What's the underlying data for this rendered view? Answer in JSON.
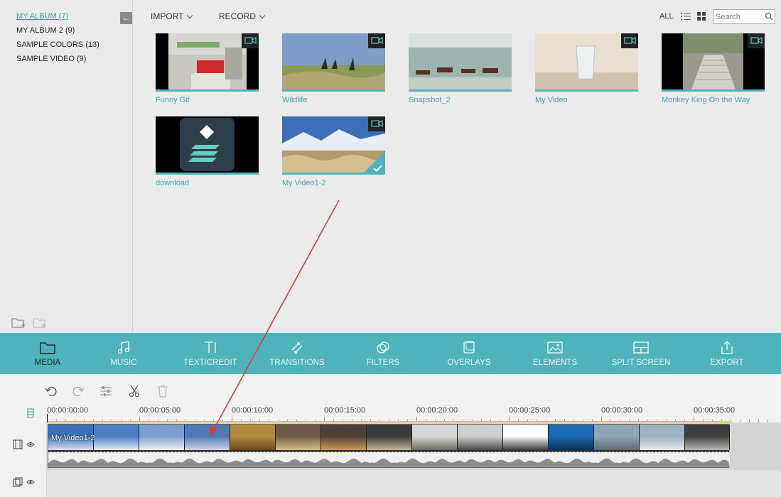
{
  "sidebar": {
    "albums": [
      {
        "label": "MY ALBUM (7)",
        "active": true
      },
      {
        "label": "MY ALBUM 2 (9)",
        "active": false
      },
      {
        "label": "SAMPLE COLORS (13)",
        "active": false
      },
      {
        "label": "SAMPLE VIDEO (9)",
        "active": false
      }
    ]
  },
  "top_toolbar": {
    "import_label": "IMPORT",
    "record_label": "RECORD",
    "all_label": "ALL",
    "search_placeholder": "Search"
  },
  "media": [
    {
      "label": "Funny Gif",
      "video": true
    },
    {
      "label": "Wildlife",
      "video": true
    },
    {
      "label": "Snapshot_2",
      "video": false
    },
    {
      "label": "My Video",
      "video": true
    },
    {
      "label": "Monkey King On the Way",
      "video": true
    },
    {
      "label": "download",
      "video": false
    },
    {
      "label": "My Video1-2",
      "video": true,
      "selected": true
    }
  ],
  "main_toolbar": [
    {
      "label": "MEDIA",
      "icon": "folder-icon",
      "active": true
    },
    {
      "label": "MUSIC",
      "icon": "music-note-icon"
    },
    {
      "label": "TEXT/CREDIT",
      "icon": "text-icon"
    },
    {
      "label": "TRANSITIONS",
      "icon": "transitions-icon"
    },
    {
      "label": "FILTERS",
      "icon": "filters-icon"
    },
    {
      "label": "OVERLAYS",
      "icon": "overlays-icon"
    },
    {
      "label": "ELEMENTS",
      "icon": "image-icon"
    },
    {
      "label": "SPLIT SCREEN",
      "icon": "split-screen-icon"
    },
    {
      "label": "EXPORT",
      "icon": "export-icon"
    }
  ],
  "timeline": {
    "ticks": [
      "00:00:00:00",
      "00:00:05:00",
      "00:00:10:00",
      "00:00:15:00",
      "00:00:20:00",
      "00:00:25:00",
      "00:00:30:00",
      "00:00:35:00"
    ],
    "clip_title": "My Video1-2"
  },
  "colors": {
    "accent": "#4fb3bb",
    "link": "#3fa3ad",
    "annotation": "#d93a3a"
  }
}
